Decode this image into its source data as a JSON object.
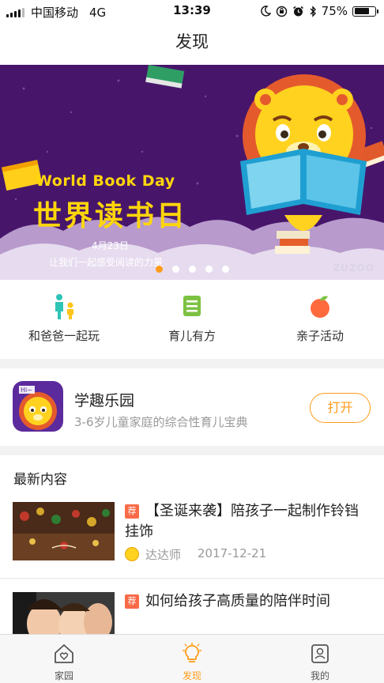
{
  "status_bar": {
    "carrier": "中国移动",
    "network": "4G",
    "time": "13:39",
    "battery": "75%",
    "battery_level": 0.75
  },
  "nav": {
    "title": "发现"
  },
  "banner": {
    "title_en": "World Book Day",
    "title_cn": "世界读书日",
    "date": "4月23日",
    "slogan": "让我们一起感受阅读的力量",
    "watermark": "ZUZOO",
    "slide_count": 5,
    "active_slide": 0
  },
  "quick_nav": [
    {
      "label": "和爸爸一起玩",
      "icon": "parent-child-icon",
      "color": "#2ec4b6"
    },
    {
      "label": "育儿有方",
      "icon": "document-icon",
      "color": "#7dc242"
    },
    {
      "label": "亲子活动",
      "icon": "apple-icon",
      "color": "#ff6a3d"
    }
  ],
  "app_card": {
    "name": "学趣乐园",
    "description": "3-6岁儿童家庭的综合性育儿宝典",
    "button": "打开",
    "logo_text": "Hi~"
  },
  "latest": {
    "title": "最新内容",
    "articles": [
      {
        "tag": "荐",
        "title": "【圣诞来袭】陪孩子一起制作铃铛挂饰",
        "author": "达达师",
        "date": "2017-12-21",
        "thumb": "christmas-bells"
      },
      {
        "tag": "荐",
        "title": "如何给孩子高质量的陪伴时间",
        "thumb": "family-photo"
      }
    ]
  },
  "tab_bar": [
    {
      "label": "家园",
      "icon": "home-icon",
      "active": false
    },
    {
      "label": "发现",
      "icon": "lightbulb-icon",
      "active": true
    },
    {
      "label": "我的",
      "icon": "profile-icon",
      "active": false
    }
  ],
  "colors": {
    "accent": "#ff9b1a",
    "banner_bg": "#47166b",
    "tag": "#f96a47"
  }
}
